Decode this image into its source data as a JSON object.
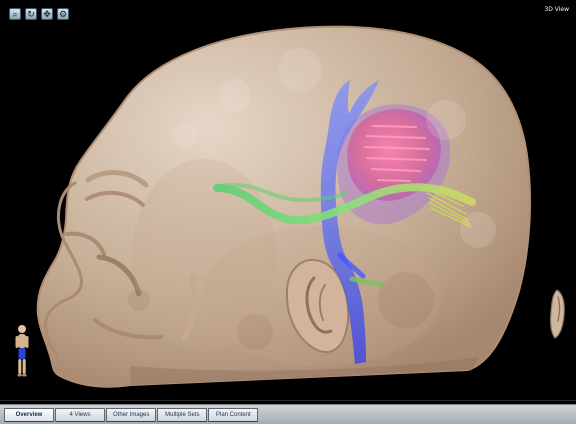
{
  "window": {
    "view_label": "3D View"
  },
  "toolbar": {
    "icons": [
      {
        "name": "zoom-icon",
        "glyph": "⌕"
      },
      {
        "name": "rotate-icon",
        "glyph": "↻"
      },
      {
        "name": "pan-icon",
        "glyph": "✥"
      },
      {
        "name": "settings-icon",
        "glyph": "⚙"
      }
    ]
  },
  "tabs": [
    {
      "label": "Overview",
      "active": true
    },
    {
      "label": "4 Views",
      "active": false
    },
    {
      "label": "Other Images",
      "active": false
    },
    {
      "label": "Multiple Sets",
      "active": false
    },
    {
      "label": "Plan Content",
      "active": false
    }
  ],
  "colors": {
    "background": "#000000",
    "skin": "#dcc1a7",
    "skin_shadow": "#b08f76",
    "blue_tract": "#5a72ff",
    "green_tract": "#86d77a",
    "pink_tumor": "#d86b99",
    "purple_overlay": "#9a6fd6",
    "yellow_fibers": "#cdd861"
  }
}
